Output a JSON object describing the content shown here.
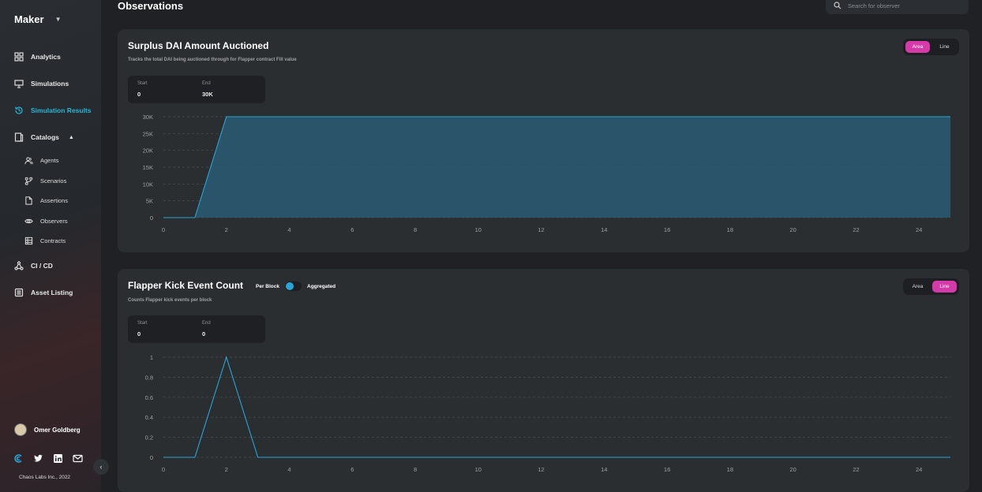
{
  "sidebar": {
    "brand": "Maker",
    "nav": {
      "analytics": "Analytics",
      "simulations": "Simulations",
      "simulation_results": "Simulation Results",
      "catalogs": "Catalogs",
      "cicd": "CI / CD",
      "asset_listing": "Asset Listing"
    },
    "catalog_items": {
      "agents": "Agents",
      "scenarios": "Scenarios",
      "assertions": "Assertions",
      "observers": "Observers",
      "contracts": "Contracts"
    },
    "user_name": "Omer Goldberg",
    "copyright": "Chaos Labs Inc., 2022"
  },
  "header": {
    "title": "Observations",
    "search_placeholder": "Search for observer"
  },
  "cards": {
    "surplus": {
      "title": "Surplus DAI Amount Auctioned",
      "subtitle": "Tracks the total DAI being auctioned through for Flapper contract Fill value",
      "toggle": {
        "area": "Area",
        "line": "Line",
        "selected": "Area"
      },
      "range": {
        "start_label": "Start",
        "start_value": "0",
        "end_label": "End",
        "end_value": "30K"
      }
    },
    "kick": {
      "title": "Flapper Kick Event Count",
      "per_block": "Per Block",
      "aggregated": "Aggregated",
      "subtitle": "Counts Flapper kick events per block",
      "toggle": {
        "area": "Area",
        "line": "Line",
        "selected": "Line"
      },
      "range": {
        "start_label": "Start",
        "start_value": "0",
        "end_label": "End",
        "end_value": "0"
      }
    }
  },
  "chart_data": [
    {
      "type": "area",
      "x_ticks": [
        0,
        2,
        4,
        6,
        8,
        10,
        12,
        14,
        16,
        18,
        20,
        22,
        24
      ],
      "y_ticks": [
        "0",
        "5K",
        "10K",
        "15K",
        "20K",
        "25K",
        "30K"
      ],
      "ylim": [
        0,
        30000
      ],
      "xlim": [
        0,
        25
      ],
      "x": [
        0,
        1,
        2,
        25
      ],
      "y": [
        0,
        0,
        30000,
        30000
      ],
      "color": "#2aa4d8"
    },
    {
      "type": "line",
      "x_ticks": [
        0,
        2,
        4,
        6,
        8,
        10,
        12,
        14,
        16,
        18,
        20,
        22,
        24
      ],
      "y_ticks": [
        "0",
        "0.2",
        "0.4",
        "0.6",
        "0.8",
        "1"
      ],
      "ylim": [
        0,
        1
      ],
      "xlim": [
        0,
        25
      ],
      "x": [
        0,
        1,
        2,
        3,
        25
      ],
      "y": [
        0,
        0,
        1,
        0,
        0
      ],
      "color": "#2aa4d8"
    }
  ]
}
